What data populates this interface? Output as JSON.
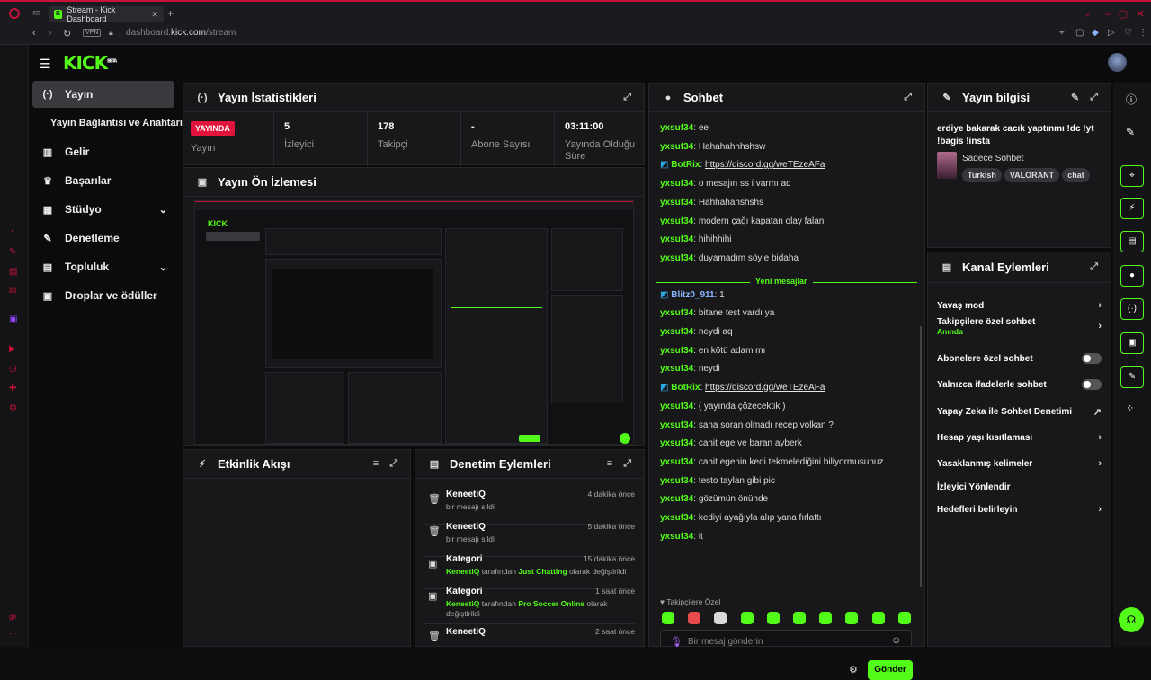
{
  "browser": {
    "tab_title": "Stream - Kick Dashboard",
    "url_domain": "dashboard.",
    "url_host": "kick.com",
    "url_path": "/stream",
    "vpn": "VPN"
  },
  "app": {
    "logo": "KICK",
    "logo_beta": "BETA"
  },
  "sidebar": {
    "items": [
      {
        "label": "Yayın",
        "icon": "broadcast-icon"
      },
      {
        "label": "Yayın Bağlantısı ve Anahtarı"
      },
      {
        "label": "Gelir",
        "icon": "chart-icon"
      },
      {
        "label": "Başarılar",
        "icon": "trophy-icon"
      },
      {
        "label": "Stüdyo",
        "icon": "studio-icon"
      },
      {
        "label": "Denetleme",
        "icon": "wrench-icon"
      },
      {
        "label": "Topluluk",
        "icon": "community-icon"
      },
      {
        "label": "Droplar ve ödüller",
        "icon": "drops-icon"
      }
    ]
  },
  "stats": {
    "title": "Yayın İstatistikleri",
    "live_badge": "YAYINDA",
    "live_label": "Yayın",
    "viewers_value": "5",
    "viewers_label": "İzleyici",
    "followers_value": "178",
    "followers_label": "Takipçi",
    "subs_value": "-",
    "subs_label": "Abone Sayısı",
    "uptime_value": "03:11:00",
    "uptime_label": "Yayında Olduğu Süre"
  },
  "preview": {
    "title": "Yayın Ön İzlemesi"
  },
  "activity": {
    "title": "Etkinlik Akışı"
  },
  "moderation": {
    "title": "Denetim Eylemleri",
    "items": [
      {
        "title": "KeneetiQ",
        "sub": "bir mesajı sildi",
        "time": "4 dakika önce"
      },
      {
        "title": "KeneetiQ",
        "sub": "bir mesajı sildi",
        "time": "5 dakika önce"
      },
      {
        "title": "Kategori",
        "actor": "KeneetiQ",
        "mid": " tarafından ",
        "cat": "Just Chatting",
        "end": " olarak değiştirildi",
        "time": "15 dakika önce"
      },
      {
        "title": "Kategori",
        "actor": "KeneetiQ",
        "mid": " tarafından ",
        "cat": "Pro Soccer Online",
        "end": " olarak değiştirildi",
        "time": "1 saat önce"
      },
      {
        "title": "KeneetiQ",
        "sub": "",
        "time": "2 saat önce"
      }
    ]
  },
  "chat": {
    "title": "Sohbet",
    "messages": [
      {
        "user": "yxsuf34",
        "text": "ee"
      },
      {
        "user": "yxsuf34",
        "text": "Hahahahhhshsw"
      },
      {
        "user": "BotRix",
        "text": "https://discord.gg/weTEzeAFa",
        "bot": true
      },
      {
        "user": "yxsuf34",
        "text": "o mesajın ss i varmı aq"
      },
      {
        "user": "yxsuf34",
        "text": "Hahhahahshshs"
      },
      {
        "user": "yxsuf34",
        "text": "modern çağı kapatan olay falan"
      },
      {
        "user": "yxsuf34",
        "text": "hihihhihi"
      },
      {
        "user": "yxsuf34",
        "text": "duyamadım söyle bidaha"
      },
      {
        "user": "Blitz0_911",
        "text": "1",
        "blue": true
      },
      {
        "user": "yxsuf34",
        "text": "bitane test vardı ya"
      },
      {
        "user": "yxsuf34",
        "text": "neydi aq"
      },
      {
        "user": "yxsuf34",
        "text": "en kötü adam mı"
      },
      {
        "user": "yxsuf34",
        "text": "neydi"
      },
      {
        "user": "BotRix",
        "text": "https://discord.gg/weTEzeAFa",
        "bot": true
      },
      {
        "user": "yxsuf34",
        "text": "( yayında çözecektik )"
      },
      {
        "user": "yxsuf34",
        "text": "sana soran olmadı recep volkan ?"
      },
      {
        "user": "yxsuf34",
        "text": "cahit ege ve baran ayberk"
      },
      {
        "user": "yxsuf34",
        "text": "cahit egenin kedi tekmelediğini biliyormusunuz"
      },
      {
        "user": "yxsuf34",
        "text": "testo taylan gibi pic"
      },
      {
        "user": "yxsuf34",
        "text": "gözümün önünde"
      },
      {
        "user": "yxsuf34",
        "text": "kediyi ayağıyla alıp yana fırlattı"
      },
      {
        "user": "yxsuf34",
        "text": "it"
      }
    ],
    "new_messages": "Yeni mesajlar",
    "followers_only": "Takipçilere Özel",
    "input_placeholder": "Bir mesaj gönderin",
    "send_label": "Gönder"
  },
  "stream_info": {
    "title": "Yayın bilgisi",
    "stream_title": "erdiye bakarak cacık yaptınmı !dc !yt !bagis !insta",
    "category": "Sadece Sohbet",
    "tags": [
      "Turkish",
      "VALORANT",
      "chat"
    ]
  },
  "channel_actions": {
    "title": "Kanal Eylemleri",
    "items": [
      {
        "label": "Yavaş mod",
        "type": "chevron"
      },
      {
        "label": "Takipçilere özel sohbet",
        "sub": "Anında",
        "type": "chevron"
      },
      {
        "label": "Abonelere özel sohbet",
        "type": "toggle"
      },
      {
        "label": "Yalnızca ifadelerle sohbet",
        "type": "toggle"
      },
      {
        "label": "Yapay Zeka ile Sohbet Denetimi",
        "type": "external"
      },
      {
        "label": "Hesap yaşı kısıtlaması",
        "type": "chevron"
      },
      {
        "label": "Yasaklanmış kelimeler",
        "type": "chevron"
      },
      {
        "label": "İzleyici Yönlendir",
        "type": "none"
      },
      {
        "label": "Hedefleri belirleyin",
        "type": "chevron"
      }
    ]
  },
  "colors": {
    "accent": "#53fc18",
    "live": "#e3143c",
    "opera": "#c4123a"
  }
}
